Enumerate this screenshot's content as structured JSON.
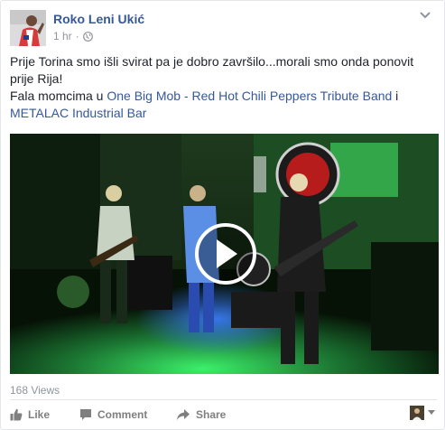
{
  "post": {
    "author": "Roko Leni Ukić",
    "time": "1 hr",
    "separator": "·",
    "privacy_icon": "globe-icon",
    "text_line1": "Prije Torina smo išli svirat pa je dobro završilo...morali smo onda ponovit prije Rija!",
    "text_line2_prefix": "Fala momcima u ",
    "mention_1": "One Big Mob - Red Hot Chili Peppers Tribute Band",
    "text_line2_mid": " i ",
    "mention_2": "METALAC Industrial Bar",
    "link_color": "#365899",
    "author_color": "#365899"
  },
  "video": {
    "play_icon": "play-icon",
    "views_label": "168 Views"
  },
  "actions": {
    "like_label": "Like",
    "comment_label": "Comment",
    "share_label": "Share",
    "like_icon": "thumbs-up-icon",
    "comment_icon": "speech-bubble-icon",
    "share_icon": "share-arrow-icon"
  },
  "viewer": {
    "dropdown_icon": "caret-down-icon"
  }
}
